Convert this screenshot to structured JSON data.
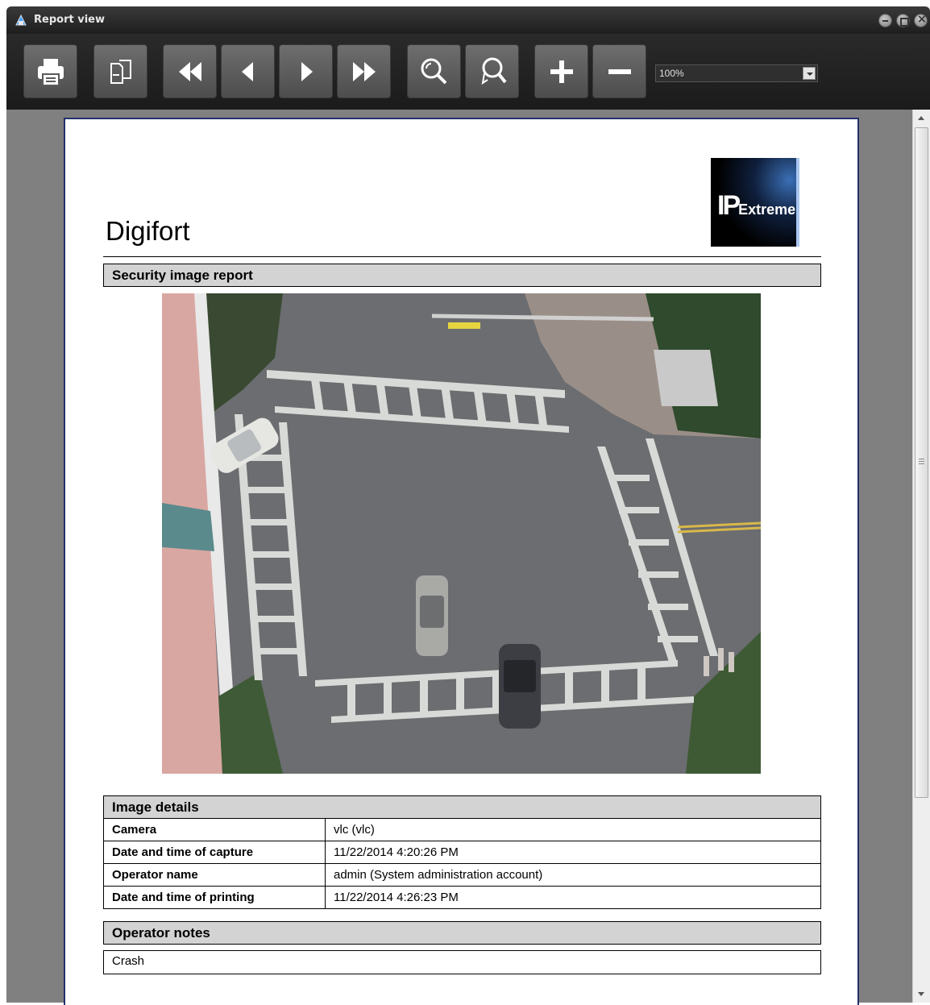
{
  "window": {
    "title": "Report view",
    "controls": [
      "minimize",
      "maximize",
      "close"
    ]
  },
  "toolbar": {
    "buttons": [
      {
        "name": "print",
        "icon": "printer-icon"
      },
      {
        "name": "page-setup",
        "icon": "pages-icon"
      },
      {
        "name": "first-page",
        "icon": "double-left-icon"
      },
      {
        "name": "previous-page",
        "icon": "left-icon"
      },
      {
        "name": "next-page",
        "icon": "right-icon"
      },
      {
        "name": "last-page",
        "icon": "double-right-icon"
      },
      {
        "name": "zoom",
        "icon": "magnifier-icon"
      },
      {
        "name": "zoom-page",
        "icon": "magnifier-pointer-icon"
      },
      {
        "name": "zoom-in",
        "icon": "plus-icon"
      },
      {
        "name": "zoom-out",
        "icon": "minus-icon"
      }
    ],
    "zoom_value": "100%"
  },
  "report": {
    "title": "Digifort",
    "logo": {
      "prefix": "IP",
      "suffix": "Extreme"
    },
    "section_title": "Security image report",
    "image_details_title": "Image details",
    "details": [
      {
        "label": "Camera",
        "value": "vlc (vlc)"
      },
      {
        "label": "Date and time of capture",
        "value": "11/22/2014 4:20:26 PM"
      },
      {
        "label": "Operator name",
        "value": "admin (System administration account)"
      },
      {
        "label": "Date and time of printing",
        "value": "11/22/2014 4:26:23 PM"
      }
    ],
    "operator_notes_title": "Operator notes",
    "operator_notes": "Crash"
  },
  "colors": {
    "toolbar_bg": "#1b1b1b",
    "button_bg": "#5e5e5e",
    "viewer_bg": "#808080",
    "page_border": "#22306a",
    "header_bg": "#d3d3d3"
  }
}
